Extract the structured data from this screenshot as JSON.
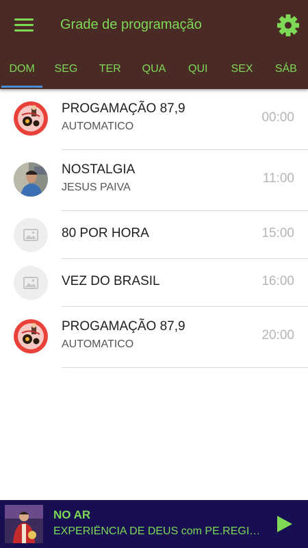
{
  "header": {
    "title": "Grade de programação",
    "menu_icon": "menu-icon",
    "settings_icon": "gear-icon",
    "accent_color": "#7ed957",
    "background_color": "#4a2a25"
  },
  "tabs": [
    {
      "label": "DOM",
      "active": true
    },
    {
      "label": "SEG"
    },
    {
      "label": "TER"
    },
    {
      "label": "QUA"
    },
    {
      "label": "QUI"
    },
    {
      "label": "SEX"
    },
    {
      "label": "SÁB"
    }
  ],
  "schedule": [
    {
      "title": "PROGAMAÇÃO 87,9",
      "host": "AUTOMATICO",
      "time": "00:00",
      "avatar": "station-logo"
    },
    {
      "title": "NOSTALGIA",
      "host": "JESUS PAIVA",
      "time": "11:00",
      "avatar": "host-photo"
    },
    {
      "title": "80 POR HORA",
      "time": "15:00",
      "avatar": "image-placeholder-icon"
    },
    {
      "title": "VEZ DO BRASIL",
      "time": "16:00",
      "avatar": "image-placeholder-icon"
    },
    {
      "title": "PROGAMAÇÃO 87,9",
      "host": "AUTOMATICO",
      "time": "20:00",
      "avatar": "station-logo"
    }
  ],
  "player": {
    "status": "NO AR",
    "track": "EXPERIÊNCIA DE DEUS com PE.REGINALDO MANZOTTI",
    "play_icon": "play-icon",
    "background_color": "#170f52"
  }
}
